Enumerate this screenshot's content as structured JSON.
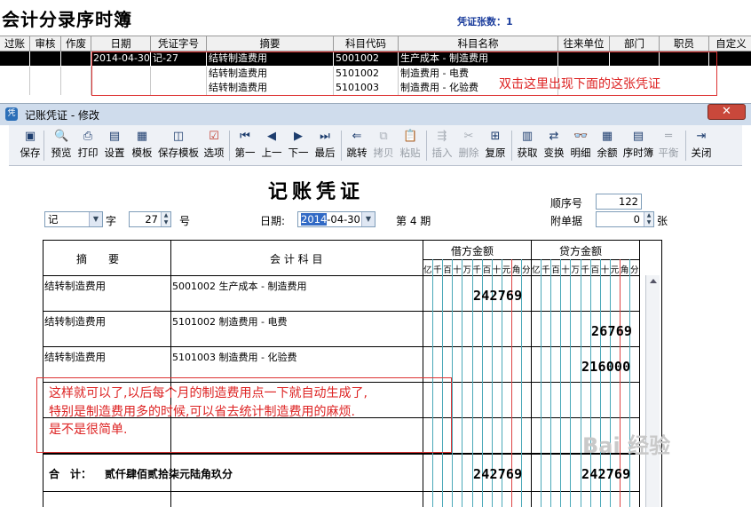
{
  "app": {
    "title": "会计分录序时簿",
    "count_label": "凭证张数：1"
  },
  "journal": {
    "headers": [
      "过账",
      "审核",
      "作废",
      "日期",
      "凭证字号",
      "摘要",
      "科目代码",
      "科目名称",
      "往来单位",
      "部门",
      "职员",
      "自定义"
    ],
    "rows": [
      {
        "date": "2014-04-30",
        "voucher": "记-27",
        "summary": "结转制造费用",
        "code": "5001002",
        "name": "生产成本 - 制造费用"
      },
      {
        "date": "",
        "voucher": "",
        "summary": "结转制造费用",
        "code": "5101002",
        "name": "制造费用 - 电费"
      },
      {
        "date": "",
        "voucher": "",
        "summary": "结转制造费用",
        "code": "5101003",
        "name": "制造费用 - 化验费"
      }
    ]
  },
  "annotation_top": "双击这里出现下面的这张凭证",
  "window": {
    "title": "记账凭证 - 修改"
  },
  "toolbar": [
    {
      "icon": "save-icon",
      "label": "保存",
      "enabled": true
    },
    {
      "icon": "preview-icon",
      "label": "预览",
      "enabled": true
    },
    {
      "icon": "print-icon",
      "label": "打印",
      "enabled": true
    },
    {
      "icon": "settings-icon",
      "label": "设置",
      "enabled": true
    },
    {
      "icon": "template-icon",
      "label": "模板",
      "enabled": true
    },
    {
      "icon": "save-template-icon",
      "label": "保存模板",
      "enabled": true
    },
    {
      "icon": "options-icon",
      "label": "选项",
      "enabled": true
    },
    {
      "icon": "first-icon",
      "label": "第一",
      "enabled": true
    },
    {
      "icon": "prev-icon",
      "label": "上一",
      "enabled": true
    },
    {
      "icon": "next-icon",
      "label": "下一",
      "enabled": true
    },
    {
      "icon": "last-icon",
      "label": "最后",
      "enabled": true
    },
    {
      "icon": "jump-icon",
      "label": "跳转",
      "enabled": true
    },
    {
      "icon": "copy-icon",
      "label": "拷贝",
      "enabled": false
    },
    {
      "icon": "paste-icon",
      "label": "粘贴",
      "enabled": false
    },
    {
      "icon": "insert-icon",
      "label": "插入",
      "enabled": false
    },
    {
      "icon": "delete-icon",
      "label": "删除",
      "enabled": false
    },
    {
      "icon": "restore-icon",
      "label": "复原",
      "enabled": true
    },
    {
      "icon": "fetch-icon",
      "label": "获取",
      "enabled": true
    },
    {
      "icon": "exchange-icon",
      "label": "变换",
      "enabled": true
    },
    {
      "icon": "detail-icon",
      "label": "明细",
      "enabled": true
    },
    {
      "icon": "balance-icon",
      "label": "余额",
      "enabled": true
    },
    {
      "icon": "journal-icon",
      "label": "序时簿",
      "enabled": true
    },
    {
      "icon": "balance-check-icon",
      "label": "平衡",
      "enabled": false
    },
    {
      "icon": "close-icon",
      "label": "关闭",
      "enabled": true
    }
  ],
  "voucher": {
    "title": "记账凭证",
    "type": "记",
    "zi_label": "字",
    "number": "27",
    "hao_label": "号",
    "date_label": "日期:",
    "date_year": "2014",
    "date_rest": "-04-30",
    "period": "第 4 期",
    "seq_label": "顺序号",
    "seq_value": "122",
    "attach_label": "附单据",
    "attach_value": "0",
    "zhang_label": "张",
    "col_summary": "摘　　要",
    "col_account": "会 计 科 目",
    "col_debit": "借方金额",
    "col_credit": "贷方金额",
    "digit_headers": [
      "亿",
      "千",
      "百",
      "十",
      "万",
      "千",
      "百",
      "十",
      "元",
      "角",
      "分"
    ],
    "entries": [
      {
        "summary": "结转制造费用",
        "account": "5001002 生产成本 - 制造费用",
        "debit": "242769",
        "credit": ""
      },
      {
        "summary": "结转制造费用",
        "account": "5101002 制造费用 - 电费",
        "debit": "",
        "credit": "26769"
      },
      {
        "summary": "结转制造费用",
        "account": "5101003 制造费用 - 化验费",
        "debit": "",
        "credit": "216000"
      }
    ],
    "total_label": "合　计：",
    "total_words": "贰仟肆佰贰拾柒元陆角玖分",
    "total_debit": "242769",
    "total_credit": "242769"
  },
  "annotation_bottom": [
    "这样就可以了,以后每个月的制造费用点一下就自动生成了,",
    "特别是制造费用多的时候,可以省去统计制造费用的麻烦.",
    "是不是很简单."
  ],
  "watermark": "Bai 经验"
}
